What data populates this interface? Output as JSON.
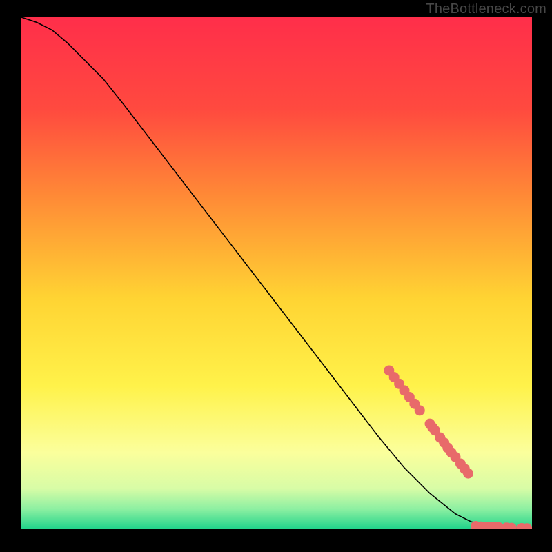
{
  "watermark": "TheBottleneck.com",
  "colors": {
    "bg": "#000000",
    "watermark": "#474747",
    "curve": "#000000",
    "marker_fill": "#e86a6a",
    "marker_stroke": "#cc5555",
    "gradient": {
      "top": "#ff2e4a",
      "mid1": "#ff6a3a",
      "mid2": "#ffd433",
      "mid3": "#fff86b",
      "mid4": "#f4ffb8",
      "mid5": "#a8f7a8",
      "bottom": "#1fd38a"
    }
  },
  "chart_data": {
    "type": "line",
    "title": "",
    "xlabel": "",
    "ylabel": "",
    "xlim": [
      0,
      100
    ],
    "ylim": [
      0,
      100
    ],
    "grid": false,
    "legend": false,
    "series": [
      {
        "name": "curve",
        "x": [
          0,
          3,
          6,
          9,
          12,
          16,
          20,
          25,
          30,
          35,
          40,
          45,
          50,
          55,
          60,
          65,
          70,
          75,
          80,
          85,
          88,
          90,
          92,
          94,
          96,
          98,
          100
        ],
        "y": [
          100,
          99,
          97.5,
          95,
          92,
          88,
          83,
          76.5,
          70,
          63.5,
          57,
          50.5,
          44,
          37.5,
          31,
          24.5,
          18,
          12,
          7,
          3,
          1.5,
          0.9,
          0.55,
          0.35,
          0.22,
          0.12,
          0.05
        ]
      }
    ],
    "markers": {
      "name": "highlighted-points",
      "type": "scatter",
      "x": [
        72,
        73,
        74,
        75,
        76,
        77,
        78,
        80,
        80.5,
        81,
        82,
        82.8,
        83.5,
        84.2,
        85,
        86,
        86.8,
        87.5,
        89,
        90,
        91,
        92,
        92.8,
        93.5,
        95,
        96,
        98,
        99
      ],
      "y": [
        31,
        29.7,
        28.4,
        27.1,
        25.8,
        24.5,
        23.2,
        20.6,
        19.9,
        19.3,
        17.9,
        16.9,
        15.9,
        15,
        14.1,
        12.8,
        11.8,
        10.9,
        0.6,
        0.5,
        0.45,
        0.4,
        0.38,
        0.35,
        0.3,
        0.26,
        0.2,
        0.17
      ]
    }
  }
}
